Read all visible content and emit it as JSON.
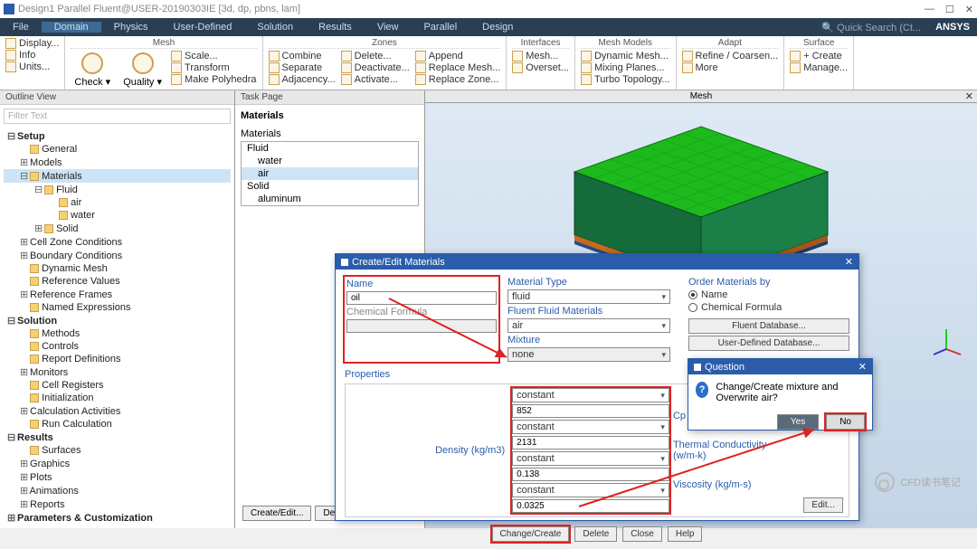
{
  "title": "Design1 Parallel Fluent@USER-20190303IE  [3d, dp, pbns, lam]",
  "menu": [
    "File",
    "Domain",
    "Physics",
    "User-Defined",
    "Solution",
    "Results",
    "View",
    "Parallel",
    "Design"
  ],
  "menu_active": 1,
  "search_ph": "Quick Search (Ct...",
  "brand": "ANSYS",
  "ribbon": {
    "g0_items": [
      "Display...",
      "Info",
      "Units..."
    ],
    "g1_hdr": "Mesh",
    "g1_big": [
      "Check",
      "Quality"
    ],
    "g1_col": [
      "Scale...",
      "Transform",
      "Make Polyhedra"
    ],
    "g2_hdr": "Zones",
    "g2_cols": [
      [
        "Combine",
        "Separate",
        "Adjacency..."
      ],
      [
        "Delete...",
        "Deactivate...",
        "Activate..."
      ],
      [
        "Append",
        "Replace Mesh...",
        "Replace Zone..."
      ]
    ],
    "g3_hdr": "Interfaces",
    "g3_col": [
      "Mesh...",
      "Overset..."
    ],
    "g4_hdr": "Mesh Models",
    "g4_col": [
      "Dynamic Mesh...",
      "Mixing Planes...",
      "Turbo Topology..."
    ],
    "g5_hdr": "Adapt",
    "g5_col": [
      "Refine / Coarsen...",
      "More"
    ],
    "g6_hdr": "Surface",
    "g6_col": [
      "+ Create",
      "Manage..."
    ]
  },
  "outline_hdr": "Outline View",
  "filter_ph": "Filter Text",
  "tree": [
    {
      "l": 1,
      "t": "Setup",
      "b": 1,
      "tg": "-"
    },
    {
      "l": 2,
      "t": "General",
      "i": 1
    },
    {
      "l": 2,
      "t": "Models",
      "tg": "+"
    },
    {
      "l": 2,
      "t": "Materials",
      "tg": "-",
      "sel": 1,
      "i": 1
    },
    {
      "l": 3,
      "t": "Fluid",
      "tg": "-",
      "i": 1
    },
    {
      "l": 4,
      "t": "air",
      "i": 1
    },
    {
      "l": 4,
      "t": "water",
      "i": 1
    },
    {
      "l": 3,
      "t": "Solid",
      "tg": "+",
      "i": 1
    },
    {
      "l": 2,
      "t": "Cell Zone Conditions",
      "tg": "+"
    },
    {
      "l": 2,
      "t": "Boundary Conditions",
      "tg": "+"
    },
    {
      "l": 2,
      "t": "Dynamic Mesh",
      "i": 1
    },
    {
      "l": 2,
      "t": "Reference Values",
      "i": 1
    },
    {
      "l": 2,
      "t": "Reference Frames",
      "tg": "+"
    },
    {
      "l": 2,
      "t": "Named Expressions",
      "i": 1
    },
    {
      "l": 1,
      "t": "Solution",
      "b": 1,
      "tg": "-"
    },
    {
      "l": 2,
      "t": "Methods",
      "i": 1
    },
    {
      "l": 2,
      "t": "Controls",
      "i": 1
    },
    {
      "l": 2,
      "t": "Report Definitions",
      "i": 1
    },
    {
      "l": 2,
      "t": "Monitors",
      "tg": "+"
    },
    {
      "l": 2,
      "t": "Cell Registers",
      "i": 1
    },
    {
      "l": 2,
      "t": "Initialization",
      "i": 1
    },
    {
      "l": 2,
      "t": "Calculation Activities",
      "tg": "+"
    },
    {
      "l": 2,
      "t": "Run Calculation",
      "i": 1
    },
    {
      "l": 1,
      "t": "Results",
      "b": 1,
      "tg": "-"
    },
    {
      "l": 2,
      "t": "Surfaces",
      "i": 1
    },
    {
      "l": 2,
      "t": "Graphics",
      "tg": "+"
    },
    {
      "l": 2,
      "t": "Plots",
      "tg": "+"
    },
    {
      "l": 2,
      "t": "Animations",
      "tg": "+"
    },
    {
      "l": 2,
      "t": "Reports",
      "tg": "+"
    },
    {
      "l": 1,
      "t": "Parameters & Customization",
      "b": 1,
      "tg": "+"
    }
  ],
  "task": {
    "hdr": "Task Page",
    "title": "Materials",
    "list_lbl": "Materials",
    "items": [
      {
        "t": "Fluid"
      },
      {
        "t": "water",
        "ind": 1
      },
      {
        "t": "air",
        "ind": 1,
        "hi": 1
      },
      {
        "t": "Solid"
      },
      {
        "t": "aluminum",
        "ind": 1
      }
    ],
    "b1": "Create/Edit...",
    "b2": "Delete"
  },
  "mesh_hdr": "Mesh",
  "matdlg": {
    "title": "Create/Edit Materials",
    "name_lbl": "Name",
    "name_val": "oil",
    "formula_lbl": "Chemical Formula",
    "formula_val": "",
    "type_lbl": "Material Type",
    "type_val": "fluid",
    "fluent_lbl": "Fluent Fluid Materials",
    "fluent_val": "air",
    "mix_lbl": "Mixture",
    "mix_val": "none",
    "order_lbl": "Order Materials by",
    "order_o1": "Name",
    "order_o2": "Chemical Formula",
    "db1": "Fluent Database...",
    "db2": "User-Defined Database...",
    "props_hdr": "Properties",
    "p1_lbl": "Density (kg/m3)",
    "p1_sel": "constant",
    "p1_val": "852",
    "p2_lbl": "Cp (Specific Heat) (j/kg-k)",
    "p2_sel": "constant",
    "p2_val": "2131",
    "p3_lbl": "Thermal Conductivity (w/m-k)",
    "p3_sel": "constant",
    "p3_val": "0.138",
    "p4_lbl": "Viscosity (kg/m-s)",
    "p4_sel": "constant",
    "p4_val": "0.0325",
    "edit_btn": "Edit...",
    "btn1": "Change/Create",
    "btn2": "Delete",
    "btn3": "Close",
    "btn4": "Help"
  },
  "qdlg": {
    "title": "Question",
    "msg": "Change/Create mixture and Overwrite air?",
    "yes": "Yes",
    "no": "No"
  },
  "watermark": "CFD读书笔记"
}
